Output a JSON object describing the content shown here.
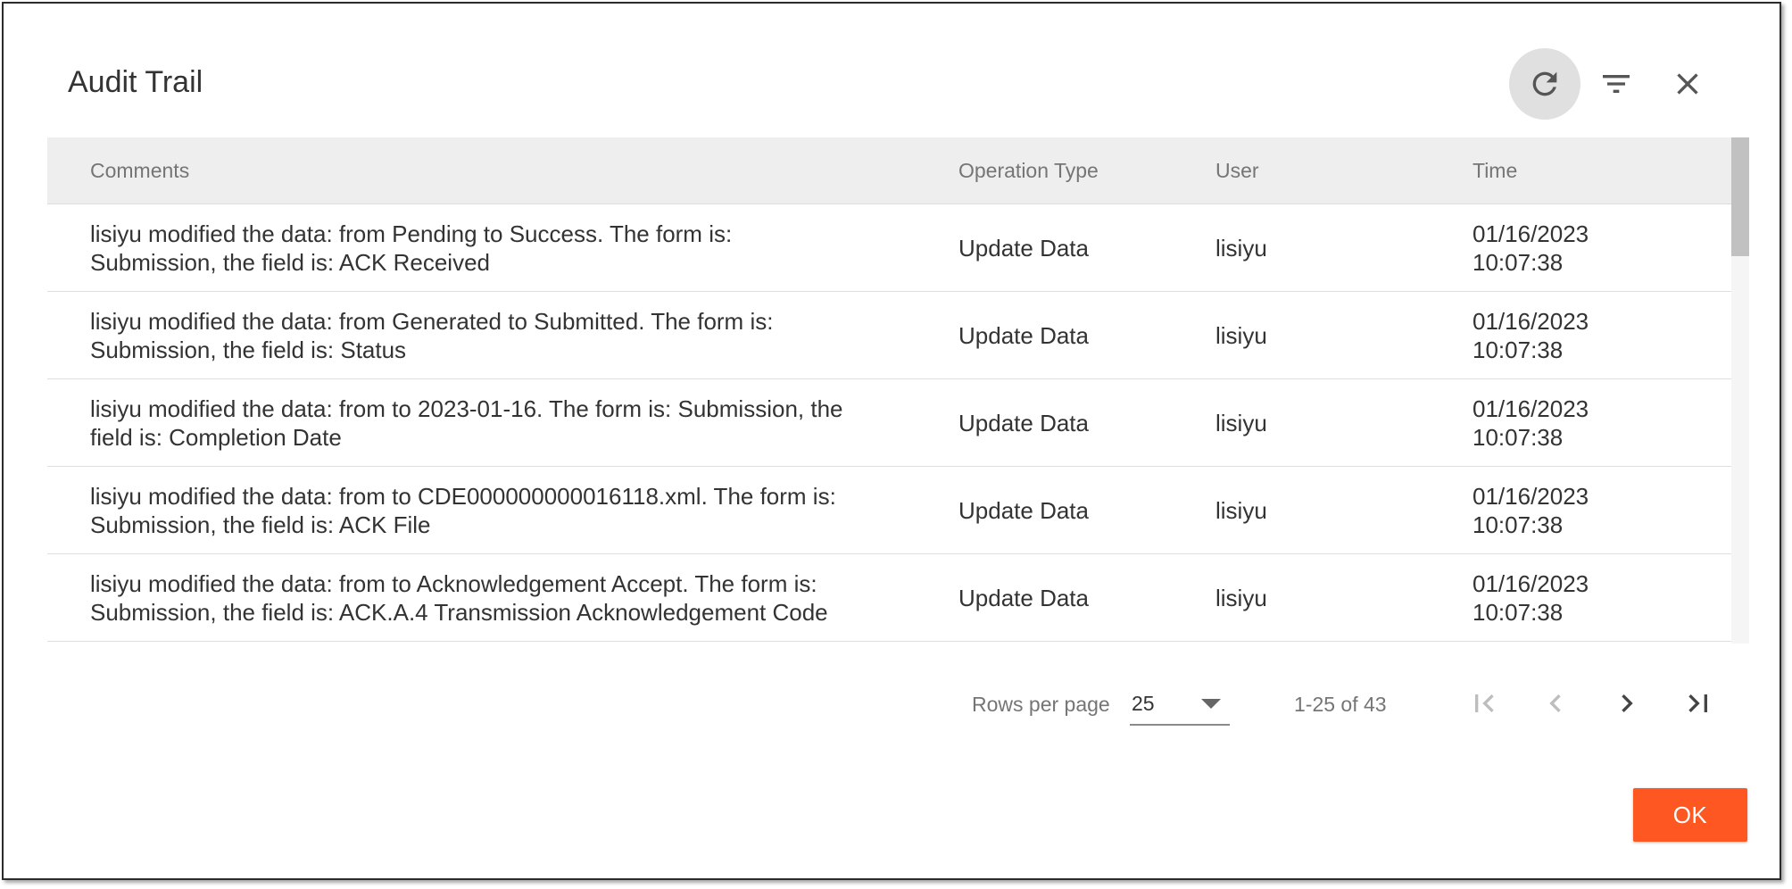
{
  "dialog": {
    "title": "Audit Trail",
    "icons": {
      "refresh": "refresh-icon",
      "filter": "filter-list-icon",
      "close": "close-icon"
    }
  },
  "table": {
    "headers": {
      "comments": "Comments",
      "operation_type": "Operation Type",
      "user": "User",
      "time": "Time"
    },
    "rows": [
      {
        "comment_line1": "lisiyu modified the data: from Pending to Success. The form is:",
        "comment_line2": "Submission, the field is: ACK Received",
        "operation_type": "Update Data",
        "user": "lisiyu",
        "date": "01/16/2023",
        "time": "10:07:38"
      },
      {
        "comment_line1": "lisiyu modified the data: from Generated to Submitted. The form is:",
        "comment_line2": "Submission, the field is: Status",
        "operation_type": "Update Data",
        "user": "lisiyu",
        "date": "01/16/2023",
        "time": "10:07:38"
      },
      {
        "comment_line1": "lisiyu modified the data: from to 2023-01-16. The form is: Submission, the",
        "comment_line2": "field is: Completion Date",
        "operation_type": "Update Data",
        "user": "lisiyu",
        "date": "01/16/2023",
        "time": "10:07:38"
      },
      {
        "comment_line1": "lisiyu modified the data: from to CDE000000000016118.xml. The form is:",
        "comment_line2": "Submission, the field is: ACK File",
        "operation_type": "Update Data",
        "user": "lisiyu",
        "date": "01/16/2023",
        "time": "10:07:38"
      },
      {
        "comment_line1": "lisiyu modified the data: from to Acknowledgement Accept. The form is:",
        "comment_line2": "Submission, the field is: ACK.A.4 Transmission Acknowledgement Code",
        "operation_type": "Update Data",
        "user": "lisiyu",
        "date": "01/16/2023",
        "time": "10:07:38"
      }
    ]
  },
  "pagination": {
    "rows_per_page_label": "Rows per page",
    "rows_per_page_value": "25",
    "range_text": "1-25 of 43",
    "icons": {
      "first": "first-page-icon",
      "prev": "chevron-left-icon",
      "next": "chevron-right-icon",
      "last": "last-page-icon"
    }
  },
  "footer": {
    "ok_label": "OK"
  },
  "colors": {
    "accent": "#ff5722",
    "header_bg": "#eeeeee",
    "text": "#333333",
    "muted_text": "#757575"
  }
}
